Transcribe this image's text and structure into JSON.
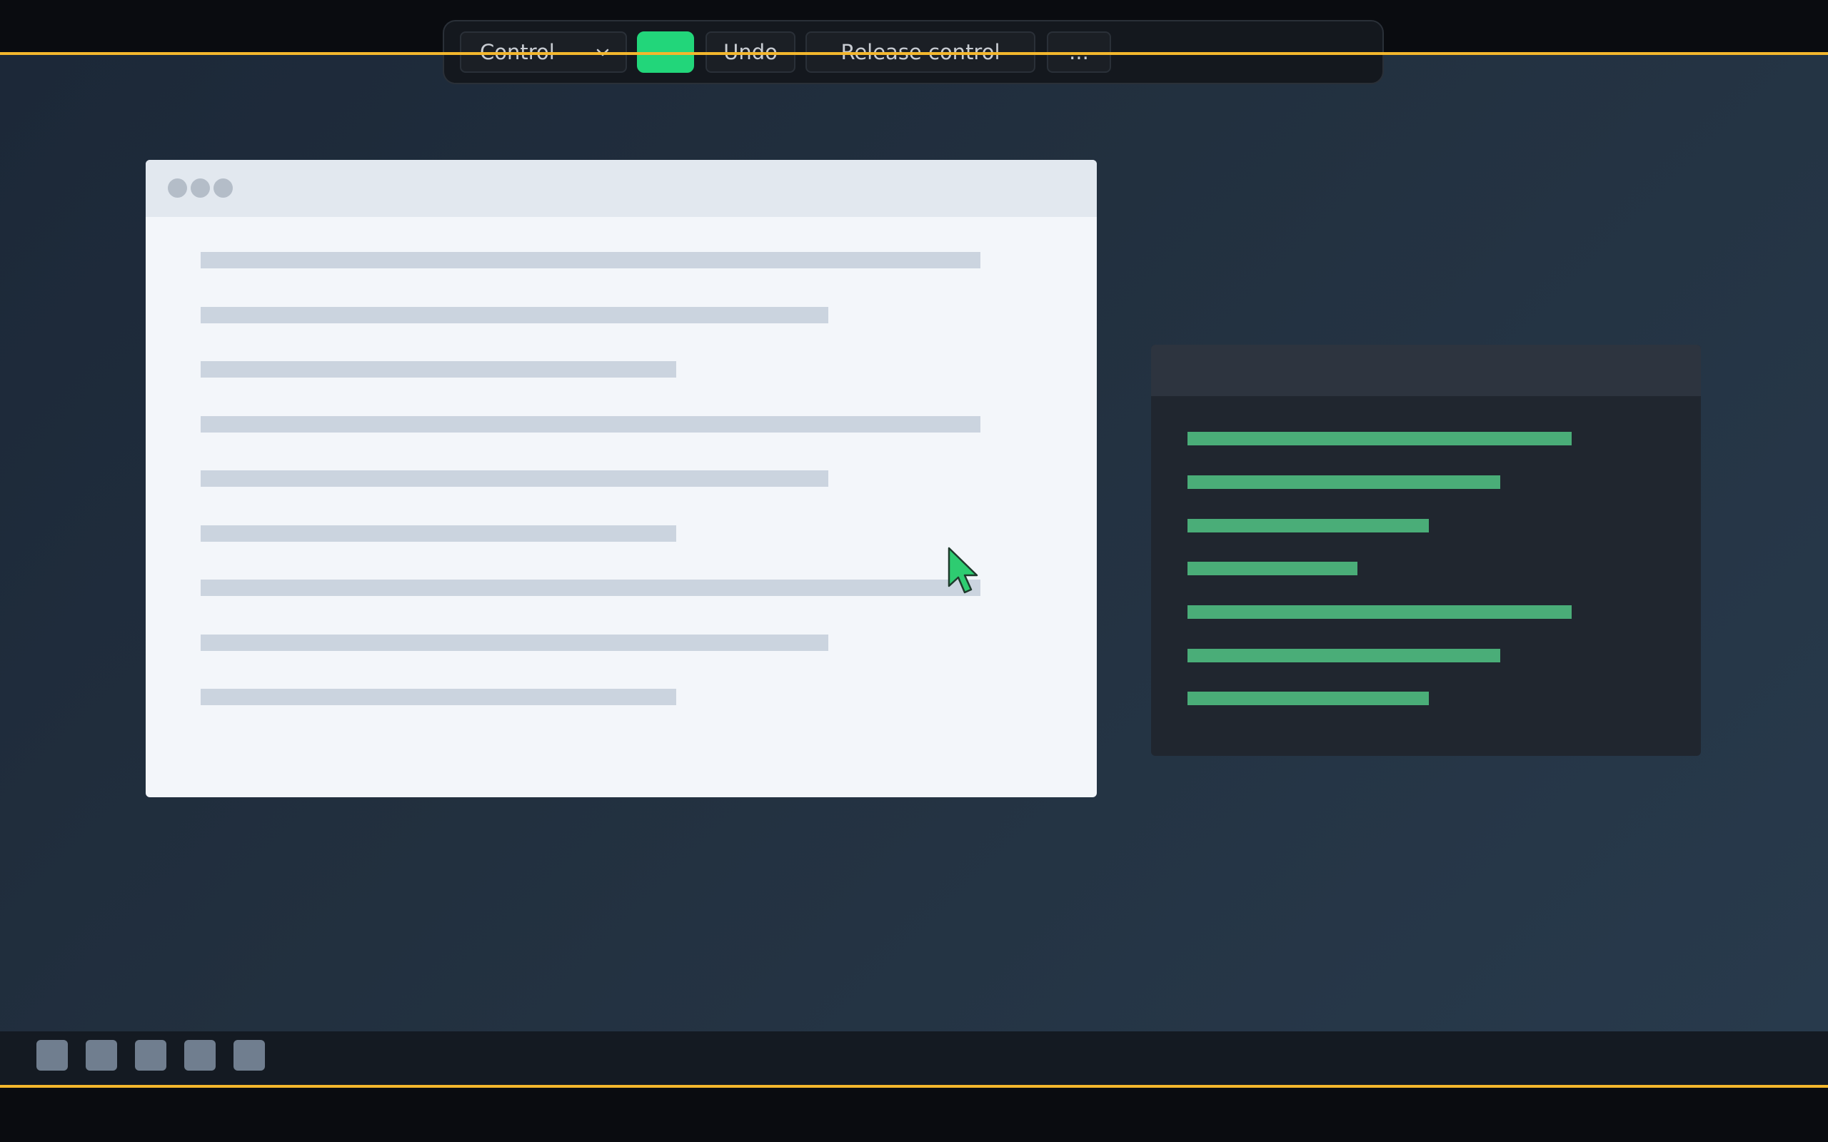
{
  "toolbar": {
    "mode_select": {
      "value": "Control"
    },
    "undo_label": "Undo",
    "release_label": "Release control",
    "more_label": "..."
  },
  "icons": {
    "select_chevron": "chevron-down-icon",
    "cursor": "mouse-pointer-icon"
  },
  "taskbar": {
    "icon_count": 5
  },
  "colors": {
    "accent_line": "#f3b72d",
    "go_button": "#22d67a",
    "cursor_fill": "#2ecc71",
    "dark_window_bars": "#4aad78"
  }
}
